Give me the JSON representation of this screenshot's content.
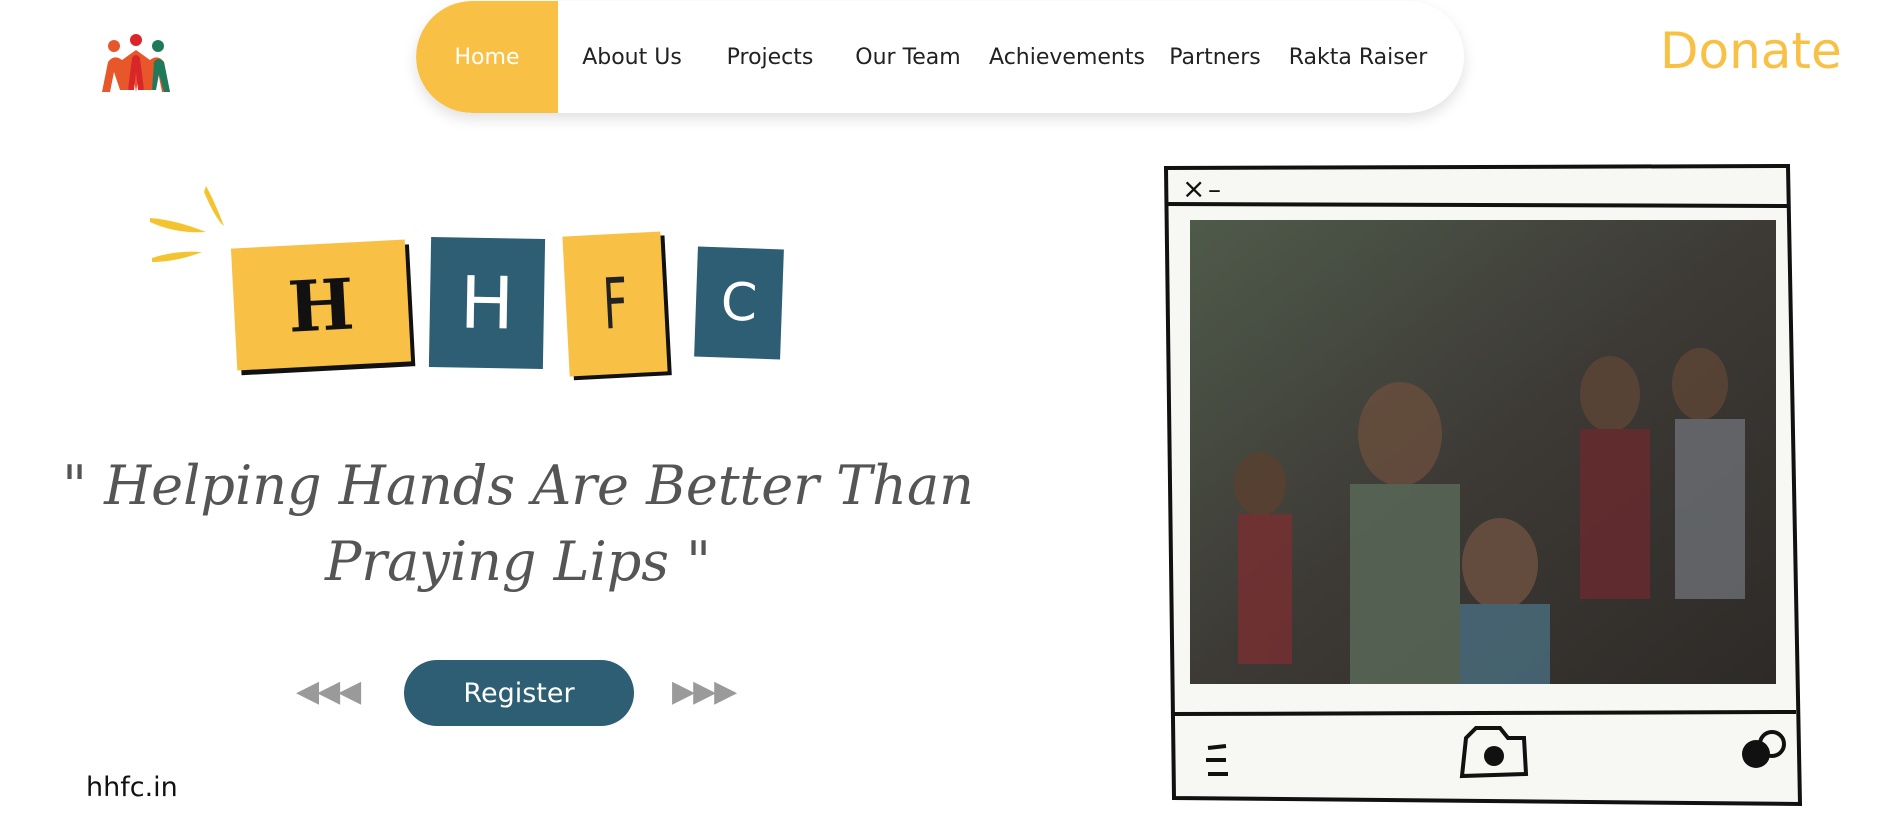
{
  "brand": {
    "logo_icon": "people-holding-hands-icon",
    "site_url": "hhfc.in"
  },
  "nav": {
    "items": [
      {
        "label": "Home",
        "active": true
      },
      {
        "label": "About Us"
      },
      {
        "label": "Projects"
      },
      {
        "label": "Our Team"
      },
      {
        "label": "Achievements"
      },
      {
        "label": "Partners"
      },
      {
        "label": "Rakta Raiser"
      }
    ],
    "donate_label": "Donate"
  },
  "hero": {
    "tiles": [
      "H",
      "H",
      "F",
      "C"
    ],
    "quote": "\" Helping Hands Are Better Than Praying Lips \"",
    "register_label": "Register"
  },
  "photo_frame": {
    "close_glyph": "×",
    "minimize_glyph": "–",
    "icons": [
      "menu-icon",
      "camera-icon",
      "toggle-icon"
    ]
  },
  "colors": {
    "accent_yellow": "#f9c046",
    "accent_teal": "#2d5e74"
  }
}
